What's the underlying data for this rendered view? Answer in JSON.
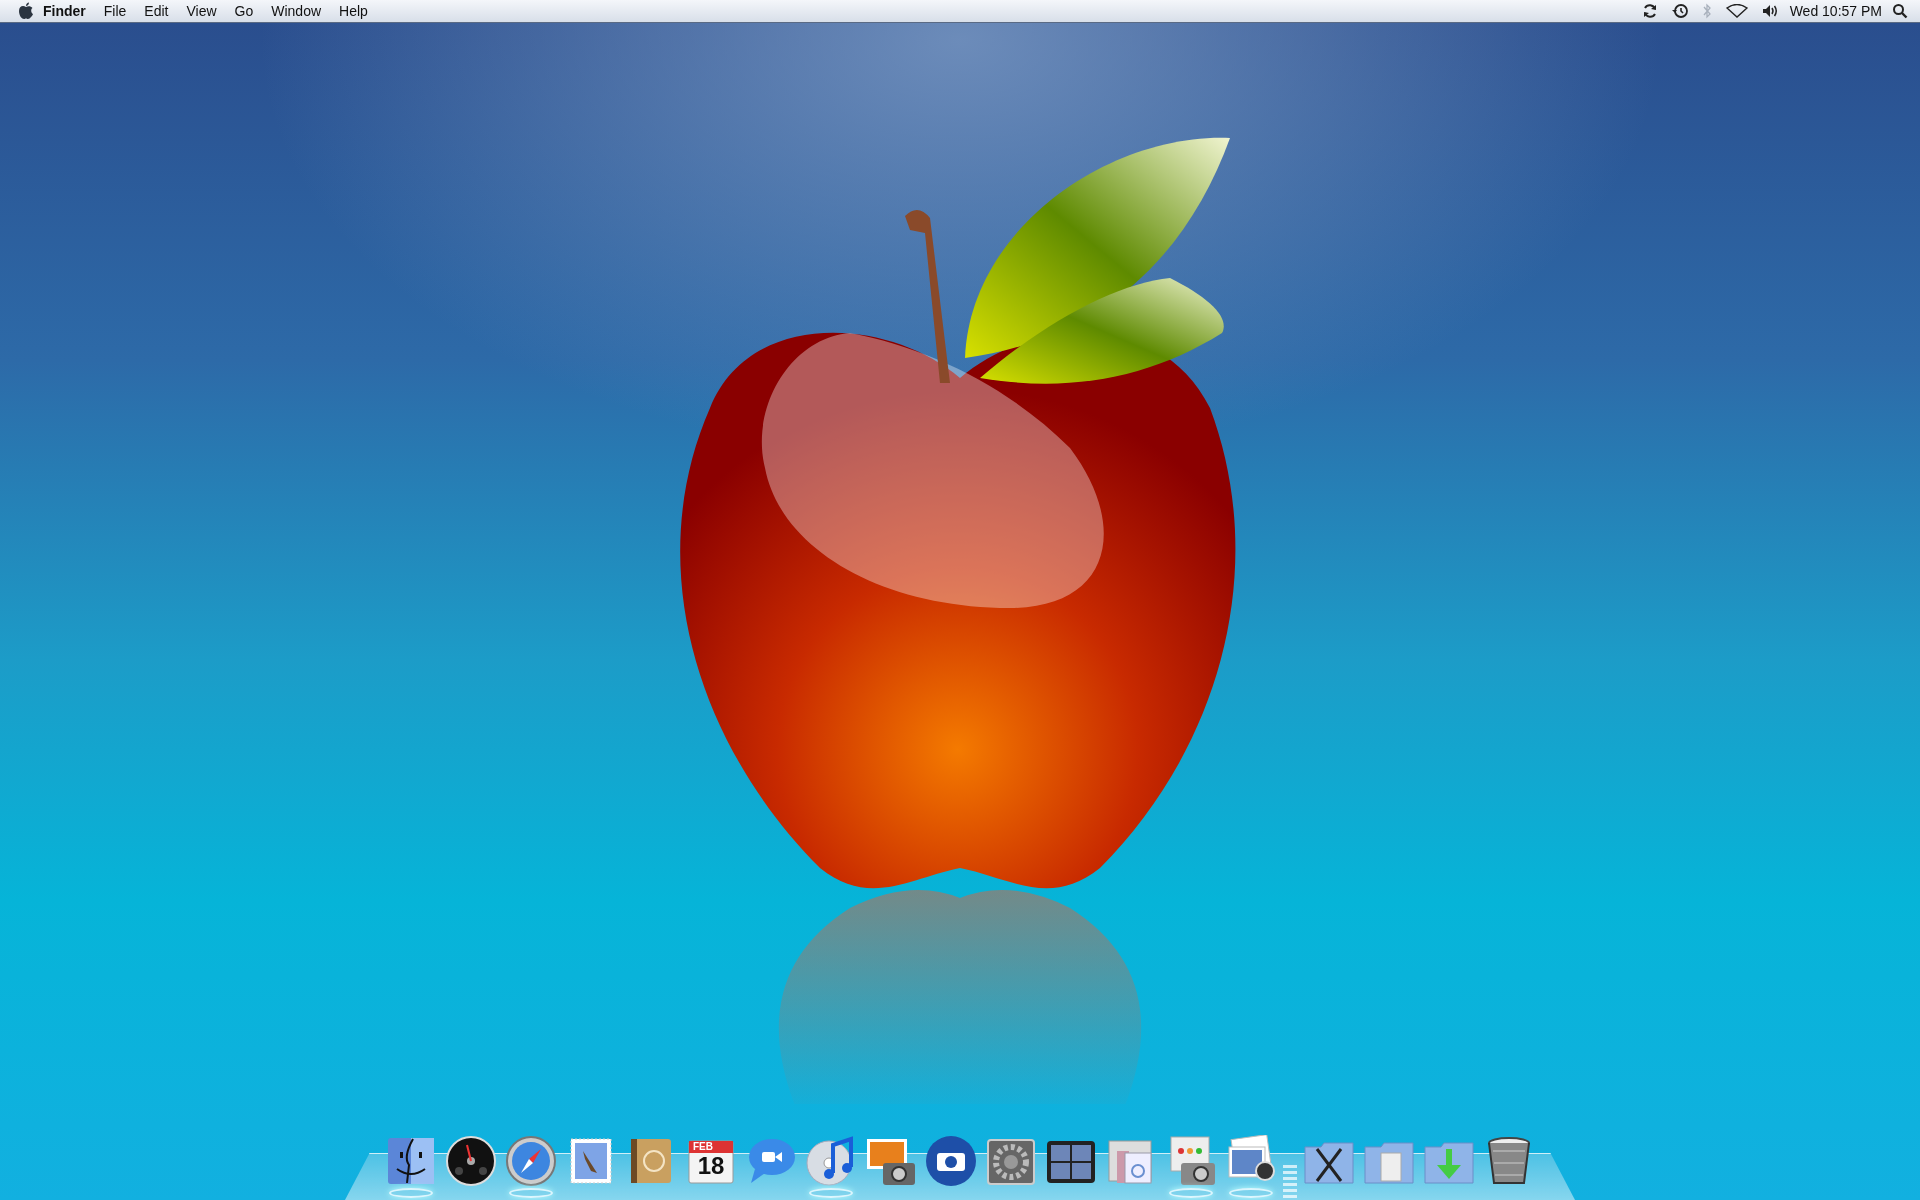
{
  "menu_bar": {
    "app_name": "Finder",
    "menus": [
      "File",
      "Edit",
      "View",
      "Go",
      "Window",
      "Help"
    ],
    "clock": "Wed 10:57 PM",
    "bluetooth_disabled": true
  },
  "dock": {
    "items": [
      {
        "kind": "finder",
        "running": true
      },
      {
        "kind": "dashboard",
        "running": false
      },
      {
        "kind": "compass",
        "running": true
      },
      {
        "kind": "stamp",
        "running": false
      },
      {
        "kind": "addressbook",
        "running": false
      },
      {
        "kind": "calendar",
        "running": false,
        "month": "FEB",
        "day": "18"
      },
      {
        "kind": "chat",
        "running": false
      },
      {
        "kind": "music",
        "running": true
      },
      {
        "kind": "photos",
        "running": false
      },
      {
        "kind": "camera",
        "running": false
      },
      {
        "kind": "gear",
        "running": false
      },
      {
        "kind": "spaces",
        "running": false
      },
      {
        "kind": "fonts",
        "running": false
      },
      {
        "kind": "capture",
        "running": true
      },
      {
        "kind": "preview",
        "running": true
      },
      {
        "kind": "separator"
      },
      {
        "kind": "apps-folder",
        "running": false
      },
      {
        "kind": "docs-folder",
        "running": false
      },
      {
        "kind": "downloads-folder",
        "running": false
      },
      {
        "kind": "trash",
        "running": false
      }
    ]
  }
}
